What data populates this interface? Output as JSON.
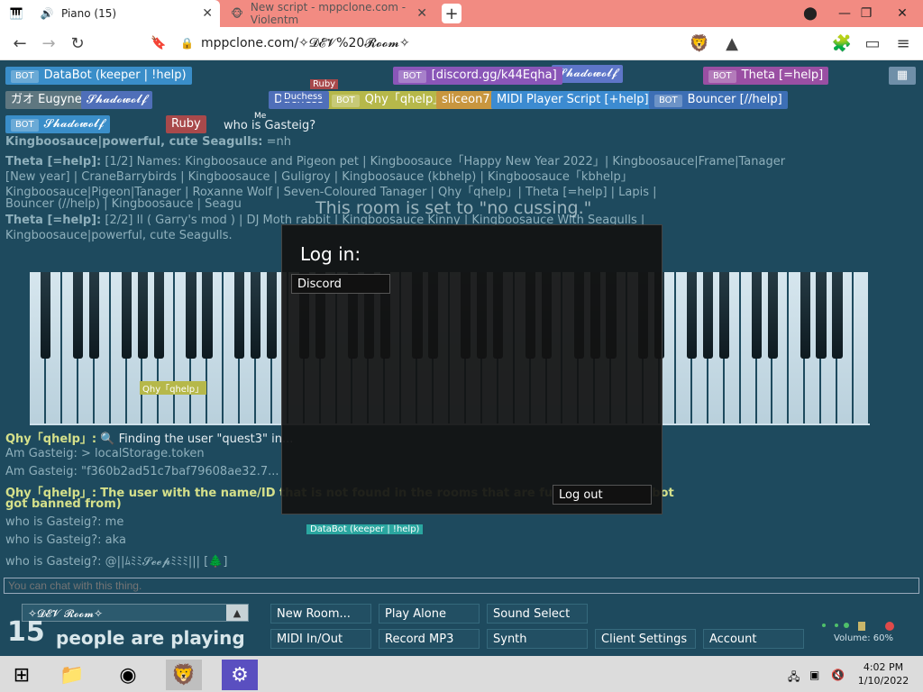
{
  "browser": {
    "tab1_title": "Piano (15)",
    "tab2_title": "New script - mppclone.com - Violentm",
    "url": "mppclone.com/✧𝓓𝓔𝓥%20𝓡𝓸𝓸𝓶✧"
  },
  "chips": [
    {
      "label": "DataBot (keeper | !help)",
      "bot": true,
      "color": "#3a8ec9"
    },
    {
      "label": "𝓢𝓱𝓪𝓭𝓸𝔀𝓸𝓵𝓯",
      "bot": false,
      "color": "#5e76c9"
    },
    {
      "label": "Theta [=help]",
      "bot": true,
      "color": "#9a4fa3"
    },
    {
      "label": "[discord.gg/k44Eqha]",
      "bot": true,
      "color": "#8a56b8"
    },
    {
      "label": "ガオ Eugyne",
      "bot": false,
      "color": "#5f7780"
    },
    {
      "label": "Qhy「qhelp」",
      "bot": false,
      "color": "#b6b84a"
    },
    {
      "label": "sliceon7",
      "bot": false,
      "color": "#c8963f"
    },
    {
      "label": "MIDI Player Script [+help]",
      "bot": false,
      "color": "#3c8bd1"
    },
    {
      "label": "Bouncer [//help]",
      "bot": true,
      "color": "#3d6fb5"
    },
    {
      "label": "Ruby",
      "bot": false,
      "color": "#a8494b"
    },
    {
      "label": "Duchess",
      "bot": false,
      "color": "#4f6fb9"
    }
  ],
  "bot_tag": "BOT",
  "chat": [
    {
      "name": "",
      "text": "who is Gasteig?",
      "color": "#e6eef2"
    },
    {
      "name": "Kingboosauce|powerful, cute Seagulls:",
      "text": "=nh",
      "color": "#8fb0bc"
    },
    {
      "name": "Theta [=help]:",
      "text": "[1/2] Names: Kingboosauce and Pigeon pet | Kingboosauce「Happy New Year 2022」| Kingboosauce|Frame|Tanager",
      "color": "#8fb0bc"
    },
    {
      "name": "",
      "text": "[New year] | CraneBarrybirds | Kingboosauce | Guligroy | Kingboosauce (kbhelp) | Kingboosauce「kbhelp」",
      "color": "#8fb0bc"
    },
    {
      "name": "",
      "text": "Kingboosauce|Pigeon|Tanager | Roxanne Wolf | Seven-Coloured Tanager | Qhy「qhelp」| Theta [=help] | Lapis |",
      "color": "#8fb0bc"
    },
    {
      "name": "",
      "text": "Bouncer (//help) | Kingboosauce | Seagu",
      "color": "#8fb0bc"
    },
    {
      "name": "Theta [=help]:",
      "text": "[2/2] ll ( Garry's mod ) | DJ Moth rabbit | Kingboosauce Kinny | Kingboosauce With Seagulls |",
      "color": "#8fb0bc"
    },
    {
      "name": "",
      "text": "Kingboosauce|powerful, cute Seagulls.",
      "color": "#8fb0bc"
    },
    {
      "name": "Qhy「qhelp」:",
      "text": "🔍 Finding the user \"quest3\" in...",
      "color": "#e6eef2"
    },
    {
      "name": "Am Gasteig:",
      "text": "> localStorage.token",
      "color": "#8fb0bc"
    },
    {
      "name": "Am Gasteig:",
      "text": "\"f360b2ad51c7baf79608ae32.7...",
      "color": "#8fb0bc"
    },
    {
      "name": "Qhy「qhelp」:",
      "text": "The user with the name/ID that is not found in the rooms that are full or the finder bot",
      "color": "#d5e08a"
    },
    {
      "name": "",
      "text": "got banned from)",
      "color": "#d5e08a"
    },
    {
      "name": "who is Gasteig?:",
      "text": "me",
      "color": "#8fb0bc"
    },
    {
      "name": "who is Gasteig?:",
      "text": "aka",
      "color": "#8fb0bc"
    },
    {
      "name": "who is Gasteig?:",
      "text": "@||ﾑﾐﾐ𝓢𝓮𝓮𝓹ﾐﾐﾐ||| [🌲]",
      "color": "#8fb0bc"
    }
  ],
  "banner": "This room is set to \"no cussing.\"",
  "modal": {
    "title": "Log in:",
    "discord_label": "Discord",
    "logout_label": "Log out"
  },
  "chat_input_placeholder": "You can chat with this thing.",
  "room_name": "✧𝓓𝓔𝓥 𝓡𝓸𝓸𝓶✧",
  "people_count": "15",
  "people_label": "people are playing",
  "buttons": {
    "new_room": "New Room...",
    "play_alone": "Play Alone",
    "sound_select": "Sound Select",
    "midi": "MIDI In/Out",
    "record": "Record MP3",
    "synth": "Synth",
    "client_settings": "Client Settings",
    "account": "Account"
  },
  "volume": "Volume: 60%",
  "cursor_labels": {
    "ruby": "Ruby",
    "duchess": "Duchess",
    "qhy": "Qhy「qhelp」",
    "databot": "DataBot (keeper | !help)",
    "me": "Me"
  },
  "clock": {
    "time": "4:02 PM",
    "date": "1/10/2022"
  }
}
